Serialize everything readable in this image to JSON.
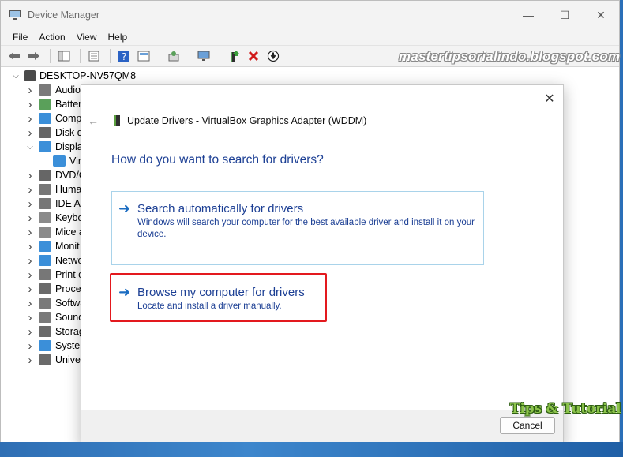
{
  "window": {
    "title": "Device Manager"
  },
  "menu": [
    "File",
    "Action",
    "View",
    "Help"
  ],
  "tree": {
    "root": "DESKTOP-NV57QM8",
    "items": [
      {
        "label": "Audio",
        "icon": "speaker-icon",
        "color": "#7a7a7a",
        "expanded": false
      },
      {
        "label": "Batteri",
        "icon": "battery-icon",
        "color": "#5aa05a",
        "expanded": false
      },
      {
        "label": "Comp",
        "icon": "computer-icon",
        "color": "#3b8fd9",
        "expanded": false
      },
      {
        "label": "Disk d",
        "icon": "disk-icon",
        "color": "#666666",
        "expanded": false
      },
      {
        "label": "Display",
        "icon": "display-icon",
        "color": "#3b8fd9",
        "expanded": true
      },
      {
        "label": "Vir",
        "icon": "display-adapter-icon",
        "color": "#3b8fd9",
        "child": true
      },
      {
        "label": "DVD/C",
        "icon": "dvd-icon",
        "color": "#666666",
        "expanded": false
      },
      {
        "label": "Huma",
        "icon": "hid-icon",
        "color": "#777777",
        "expanded": false
      },
      {
        "label": "IDE AT",
        "icon": "ide-icon",
        "color": "#777777",
        "expanded": false
      },
      {
        "label": "Keybo",
        "icon": "keyboard-icon",
        "color": "#8a8a8a",
        "expanded": false
      },
      {
        "label": "Mice a",
        "icon": "mouse-icon",
        "color": "#8a8a8a",
        "expanded": false
      },
      {
        "label": "Monit",
        "icon": "monitor-icon",
        "color": "#3b8fd9",
        "expanded": false
      },
      {
        "label": "Netwo",
        "icon": "network-icon",
        "color": "#3b8fd9",
        "expanded": false
      },
      {
        "label": "Print c",
        "icon": "printer-icon",
        "color": "#777777",
        "expanded": false
      },
      {
        "label": "Proces",
        "icon": "processor-icon",
        "color": "#6a6a6a",
        "expanded": false
      },
      {
        "label": "Softwa",
        "icon": "software-icon",
        "color": "#7a7a7a",
        "expanded": false
      },
      {
        "label": "Sound",
        "icon": "sound-icon",
        "color": "#7a7a7a",
        "expanded": false
      },
      {
        "label": "Storag",
        "icon": "storage-icon",
        "color": "#6a6a6a",
        "expanded": false
      },
      {
        "label": "System",
        "icon": "system-icon",
        "color": "#3b8fd9",
        "expanded": false
      },
      {
        "label": "Univer",
        "icon": "usb-icon",
        "color": "#6a6a6a",
        "expanded": false
      }
    ]
  },
  "watermark": "mastertipsorialindo.blogspot.com",
  "dialog": {
    "title": "Update Drivers - VirtualBox Graphics Adapter (WDDM)",
    "question": "How do you want to search for drivers?",
    "option_auto": {
      "title": "Search automatically for drivers",
      "desc": "Windows will search your computer for the best available driver and install it on your device."
    },
    "option_browse": {
      "title": "Browse my computer for drivers",
      "desc": "Locate and install a driver manually."
    },
    "cancel": "Cancel"
  },
  "logo": "Tips & Tutorial",
  "colors": {
    "accent": "#1c3f94",
    "arrow": "#1c6dc2",
    "highlight": "#e3191e"
  }
}
